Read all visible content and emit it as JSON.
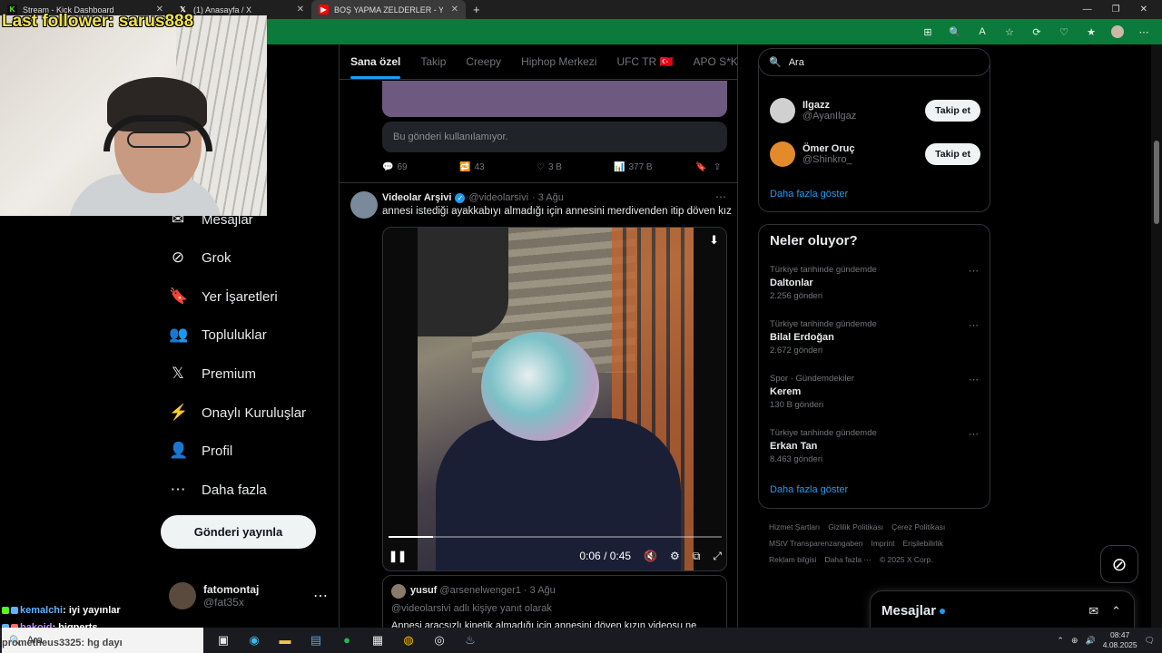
{
  "browser": {
    "tabs": [
      {
        "title": "Stream - Kick Dashboard",
        "icon": "K",
        "icon_color": "#53fc18"
      },
      {
        "title": "(1) Anasayfa / X",
        "icon": "𝕏",
        "icon_color": "#ffffff"
      },
      {
        "title": "BOŞ YAPMA ZELDERLER - YouTub",
        "icon": "▶",
        "icon_color": "#ff0000"
      }
    ],
    "new_tab": "+",
    "window_controls": [
      "—",
      "❐",
      "✕"
    ],
    "toolbar_icons": [
      "⊞",
      "🔍",
      "A",
      "☆",
      "⟳",
      "♡",
      "★",
      "⋯"
    ]
  },
  "stream_overlay": {
    "last_follower": "Last follower: sarus888",
    "chat": [
      {
        "user": "kemalchi",
        "message": ": iyi yayınlar"
      },
      {
        "user": "bakoid",
        "message": ": bigperts"
      },
      {
        "user": "prometheus3325",
        "message": ": hg dayı"
      }
    ]
  },
  "nav": {
    "items": [
      {
        "label": "Mesajlar",
        "icon": "✉"
      },
      {
        "label": "Grok",
        "icon": "⊘"
      },
      {
        "label": "Yer İşaretleri",
        "icon": "🔖"
      },
      {
        "label": "Topluluklar",
        "icon": "👥"
      },
      {
        "label": "Premium",
        "icon": "𝕏"
      },
      {
        "label": "Onaylı Kuruluşlar",
        "icon": "⚡"
      },
      {
        "label": "Profil",
        "icon": "👤"
      },
      {
        "label": "Daha fazla",
        "icon": "⋯"
      }
    ],
    "post_button": "Gönderi yayınla",
    "account": {
      "name": "fatomontaj",
      "handle": "@fat35x",
      "more": "⋯"
    }
  },
  "feed": {
    "tabs": [
      "Sana özel",
      "Takip",
      "Creepy",
      "Hiphop Merkezi",
      "UFC TR 🇹🇷",
      "APO S*KEN"
    ],
    "prev_post": {
      "unavailable": "Bu gönderi kullanılamıyor.",
      "replies": "69",
      "reposts": "43",
      "likes": "3 B",
      "views": "377 B"
    },
    "post": {
      "name": "Videolar Arşivi",
      "handle": "@videolarsivi",
      "date": "· 3 Ağu",
      "text": "annesi istediği ayakkabıyı almadığı için annesini merdivenden itip döven kız",
      "video_time": "0:06 / 0:45",
      "progress": 0.133
    },
    "reply": {
      "name": "yusuf",
      "handle": "@arsenelwenger1",
      "date": "· 3 Ağu",
      "sub": "@videolarsivi adlı kişiye yanıt olarak",
      "text": "Annesi araçsızlı kinetik almadığı için annesini döven kızın videosu ne"
    }
  },
  "sidebar": {
    "search_placeholder": "Ara",
    "who_to_follow": [
      {
        "name": "Ilgazz",
        "handle": "@AyanIlgaz",
        "button": "Takip et",
        "avatar_color": "#d0d0d0"
      },
      {
        "name": "Ömer Oruç",
        "handle": "@Shinkro_",
        "button": "Takip et",
        "avatar_color": "#e38a2a"
      }
    ],
    "show_more": "Daha fazla göster",
    "trends_title": "Neler oluyor?",
    "trends": [
      {
        "category": "Türkiye tarihinde gündemde",
        "title": "Daltonlar",
        "count": "2.256 gönderi"
      },
      {
        "category": "Türkiye tarihinde gündemde",
        "title": "Bilal Erdoğan",
        "count": "2.672 gönderi"
      },
      {
        "category": "Spor · Gündemdekiler",
        "title": "Kerem",
        "count": "130 B gönderi"
      },
      {
        "category": "Türkiye tarihinde gündemde",
        "title": "Erkan Tan",
        "count": "8.463 gönderi"
      }
    ],
    "trends_more": "Daha fazla göster",
    "footer": [
      "Hizmet Şartları",
      "Gizlilik Politikası",
      "Çerez Politikası",
      "MStV Transparenzangaben",
      "Imprint",
      "Erişilebilirlik",
      "Reklam bilgisi",
      "Daha fazla ⋯",
      "© 2025 X Corp."
    ]
  },
  "messages_drawer": {
    "title": "Mesajlar"
  },
  "taskbar": {
    "search": "Ara",
    "time": "08:47",
    "date": "4.08.2025"
  }
}
